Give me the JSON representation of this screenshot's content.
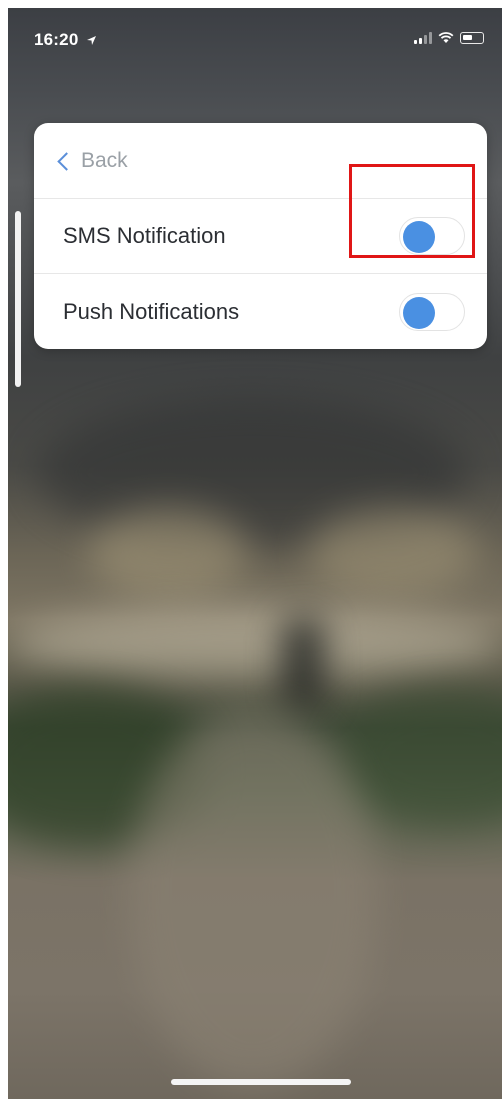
{
  "status_bar": {
    "time": "16:20",
    "location_icon": "location-arrow-icon",
    "signal_icon": "cellular-signal-icon",
    "wifi_icon": "wifi-icon",
    "battery_icon": "battery-icon"
  },
  "nav": {
    "back_label": "Back",
    "back_icon": "chevron-left-icon"
  },
  "settings": {
    "sms": {
      "label": "SMS Notification",
      "enabled": false
    },
    "push": {
      "label": "Push Notifications",
      "enabled": false
    }
  },
  "colors": {
    "accent": "#4a90e2",
    "back_chevron": "#5b8fd9",
    "highlight": "#e01616"
  }
}
